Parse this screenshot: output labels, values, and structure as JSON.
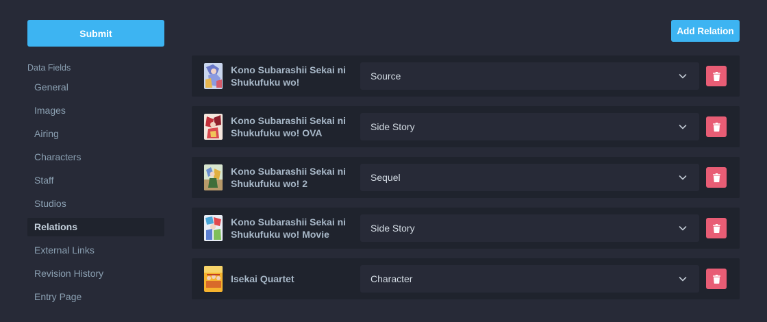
{
  "sidebar": {
    "submit_label": "Submit",
    "section_label": "Data Fields",
    "items": [
      {
        "label": "General"
      },
      {
        "label": "Images"
      },
      {
        "label": "Airing"
      },
      {
        "label": "Characters"
      },
      {
        "label": "Staff"
      },
      {
        "label": "Studios"
      },
      {
        "label": "Relations",
        "active": true
      },
      {
        "label": "External Links"
      },
      {
        "label": "Revision History"
      },
      {
        "label": "Entry Page"
      }
    ]
  },
  "main": {
    "add_relation_label": "Add Relation",
    "relations": [
      {
        "title": "Kono Subarashii Sekai ni Shukufuku wo!",
        "relation_type": "Source"
      },
      {
        "title": "Kono Subarashii Sekai ni Shukufuku wo! OVA",
        "relation_type": "Side Story"
      },
      {
        "title": "Kono Subarashii Sekai ni Shukufuku wo! 2",
        "relation_type": "Sequel"
      },
      {
        "title": "Kono Subarashii Sekai ni Shukufuku wo! Movie",
        "relation_type": "Side Story"
      },
      {
        "title": "Isekai Quartet",
        "relation_type": "Character"
      }
    ]
  },
  "icons": {
    "select_arrow": "chevron-down-icon",
    "delete": "trash-icon"
  },
  "colors": {
    "background": "#272a37",
    "panel": "#1f232d",
    "accent": "#3db4f2",
    "danger": "#e85d75",
    "text": "#9fadbd"
  }
}
